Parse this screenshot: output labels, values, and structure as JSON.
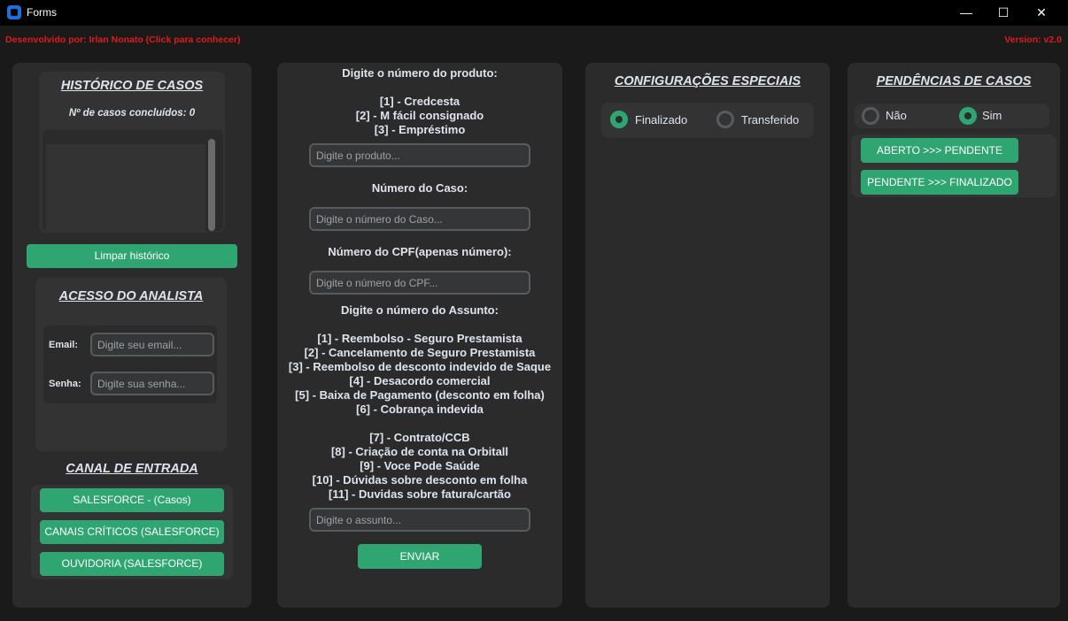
{
  "window": {
    "title": "Forms",
    "minimize": "—",
    "maximize": "☐",
    "close": "✕"
  },
  "header": {
    "developer": "Desenvolvido por: Irlan Nonato (Click para conhecer)",
    "version": "Version: v2.0"
  },
  "history": {
    "title": "HISTÓRICO DE CASOS",
    "count_label": "Nº de casos concluídos: 0",
    "clear_button": "Limpar histórico"
  },
  "login": {
    "title": "ACESSO DO ANALISTA",
    "email_label": "Email:",
    "email_placeholder": "Digite seu email...",
    "password_label": "Senha:",
    "password_placeholder": "Digite sua senha..."
  },
  "channel": {
    "title": "CANAL DE ENTRADA",
    "buttons": [
      "SALESFORCE - (Casos)",
      "CANAIS CRÍTICOS (SALESFORCE)",
      "OUVIDORIA (SALESFORCE)"
    ]
  },
  "form": {
    "product_title": "Digite o número do produto:",
    "products": [
      "[1] - Credcesta",
      "[2] - M fácil consignado",
      "[3] - Empréstimo"
    ],
    "product_placeholder": "Digite o produto...",
    "case_title": "Número do Caso:",
    "case_placeholder": "Digite o número do Caso...",
    "cpf_title": "Número do CPF(apenas número):",
    "cpf_placeholder": "Digite o número do CPF...",
    "subject_title": "Digite o número do Assunto:",
    "subjects": [
      "[1] - Reembolso - Seguro Prestamista",
      "[2] - Cancelamento de Seguro Prestamista",
      "[3] - Reembolso de desconto indevido de Saque",
      "[4] - Desacordo comercial",
      "[5] - Baixa de Pagamento (desconto em folha)",
      "[6] - Cobrança indevida",
      "[7] - Contrato/CCB",
      "[8] - Criação de conta na Orbitall",
      "[9] - Voce Pode Saúde",
      "[10] - Dúvidas sobre desconto em folha",
      "[11] - Duvidas sobre fatura/cartão"
    ],
    "subject_placeholder": "Digite o assunto...",
    "submit": "ENVIAR"
  },
  "special": {
    "title": "CONFIGURAÇÕES ESPECIAIS",
    "options": [
      {
        "label": "Finalizado",
        "selected": true
      },
      {
        "label": "Transferido",
        "selected": false
      }
    ]
  },
  "pending": {
    "title": "PENDÊNCIAS DE CASOS",
    "options": [
      {
        "label": "Não",
        "selected": false
      },
      {
        "label": "Sim",
        "selected": true
      }
    ],
    "buttons": [
      "ABERTO >>> PENDENTE",
      "PENDENTE >>> FINALIZADO"
    ]
  },
  "colors": {
    "accent": "#2fa572",
    "warning": "#e01b1b",
    "panel": "#2b2b2b",
    "subpanel": "#333333",
    "background": "#1a1a1a"
  }
}
